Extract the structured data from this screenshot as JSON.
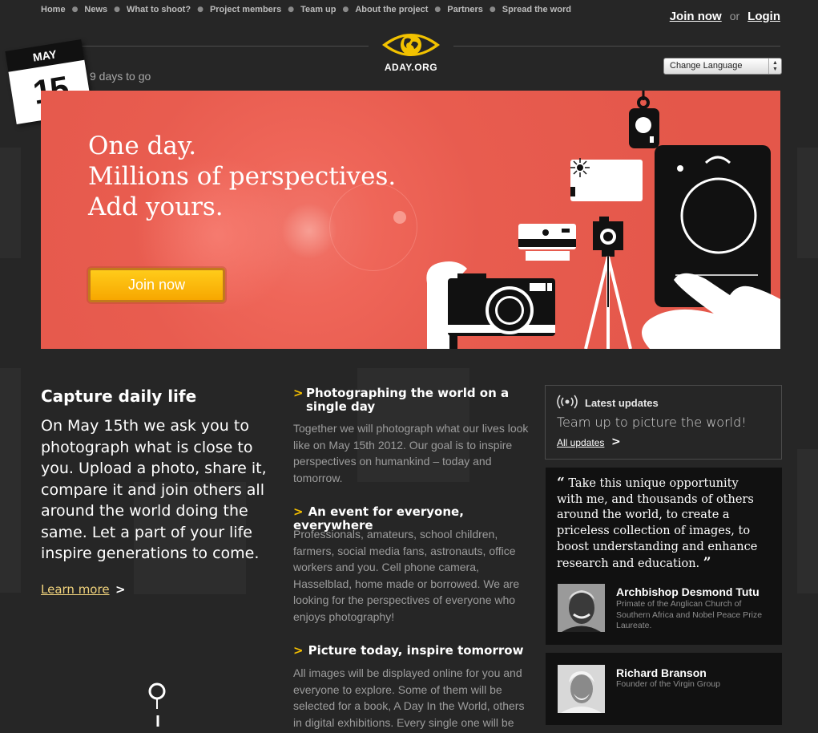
{
  "nav": {
    "items": [
      "Home",
      "News",
      "What to shoot?",
      "Project members",
      "Team up",
      "About the project",
      "Partners",
      "Spread the word"
    ],
    "join": "Join now",
    "or": "or",
    "login": "Login"
  },
  "logo": {
    "text": "ADAY.ORG"
  },
  "calendar": {
    "month": "MAY",
    "day": "15"
  },
  "countdown": "9 days to go",
  "language": {
    "selected": "Change Language"
  },
  "hero": {
    "line1": "One day.",
    "line2": "Millions of perspectives.",
    "line3": "Add yours.",
    "button": "Join now"
  },
  "capture": {
    "title": "Capture daily life",
    "text": "On May 15th we ask you to photograph what is close to you. Upload a photo, share it, compare it and join others all around the world doing the same. Let a part of your life inspire generations to come.",
    "learn_more": "Learn more",
    "arrow": ">"
  },
  "sections": [
    {
      "arrow": ">",
      "title": "Photographing the world on a single day",
      "text": "Together we will photograph what our lives look like on May 15th 2012. Our goal is to inspire perspectives on humankind – today and tomorrow."
    },
    {
      "arrow": ">",
      "title": "An event for everyone, everywhere",
      "text": "Professionals, amateurs, school children, farmers, social media fans, astronauts, office workers and you. Cell phone camera, Hasselblad, home made or borrowed. We are looking for the perspectives of everyone who enjoys photography!"
    },
    {
      "arrow": ">",
      "title": "Picture today, inspire tomorrow",
      "text": "All images will be displayed online for you and everyone to explore. Some of them will be selected for a book, A Day In the World, others in digital exhibitions. Every single one will be"
    }
  ],
  "updates": {
    "heading": "Latest updates",
    "headline": "Team up to picture the world!",
    "all_link": "All updates",
    "arrow": ">"
  },
  "quote": {
    "open": "“",
    "text": "Take this unique opportunity with me, and thousands of others around the world, to create a priceless collection of images, to boost understanding and enhance research and education.",
    "close": "”"
  },
  "people": [
    {
      "name": "Archbishop Desmond Tutu",
      "role": "Primate of the Anglican Church of Southern Africa and Nobel Peace Prize Laureate."
    },
    {
      "name": "Richard Branson",
      "role": "Founder of the Virgin Group"
    }
  ]
}
